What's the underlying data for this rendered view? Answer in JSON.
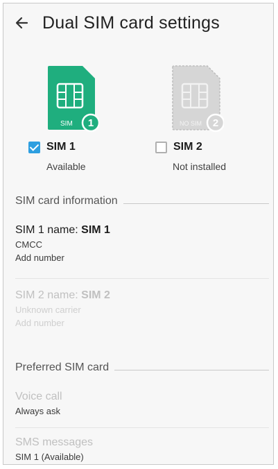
{
  "header": {
    "title": "Dual SIM card settings"
  },
  "sims": [
    {
      "badge": "SIM",
      "number": "1",
      "label": "SIM 1",
      "status": "Available",
      "checked": true,
      "color": "#1fae7e"
    },
    {
      "badge": "NO SIM",
      "number": "2",
      "label": "SIM 2",
      "status": "Not installed",
      "checked": false,
      "color": "#d6d6d6"
    }
  ],
  "sim_info": {
    "heading": "SIM card information",
    "sim1": {
      "name_prefix": "SIM 1 name: ",
      "name_value": "SIM 1",
      "carrier": "CMCC",
      "add": "Add number"
    },
    "sim2": {
      "name_prefix": "SIM 2 name: ",
      "name_value": "SIM 2",
      "carrier": "Unknown carrier",
      "add": "Add number"
    }
  },
  "preferred": {
    "heading": "Preferred SIM card",
    "voice": {
      "label": "Voice call",
      "value": "Always ask"
    },
    "sms": {
      "label": "SMS messages",
      "value": "SIM 1 (Available)"
    }
  }
}
